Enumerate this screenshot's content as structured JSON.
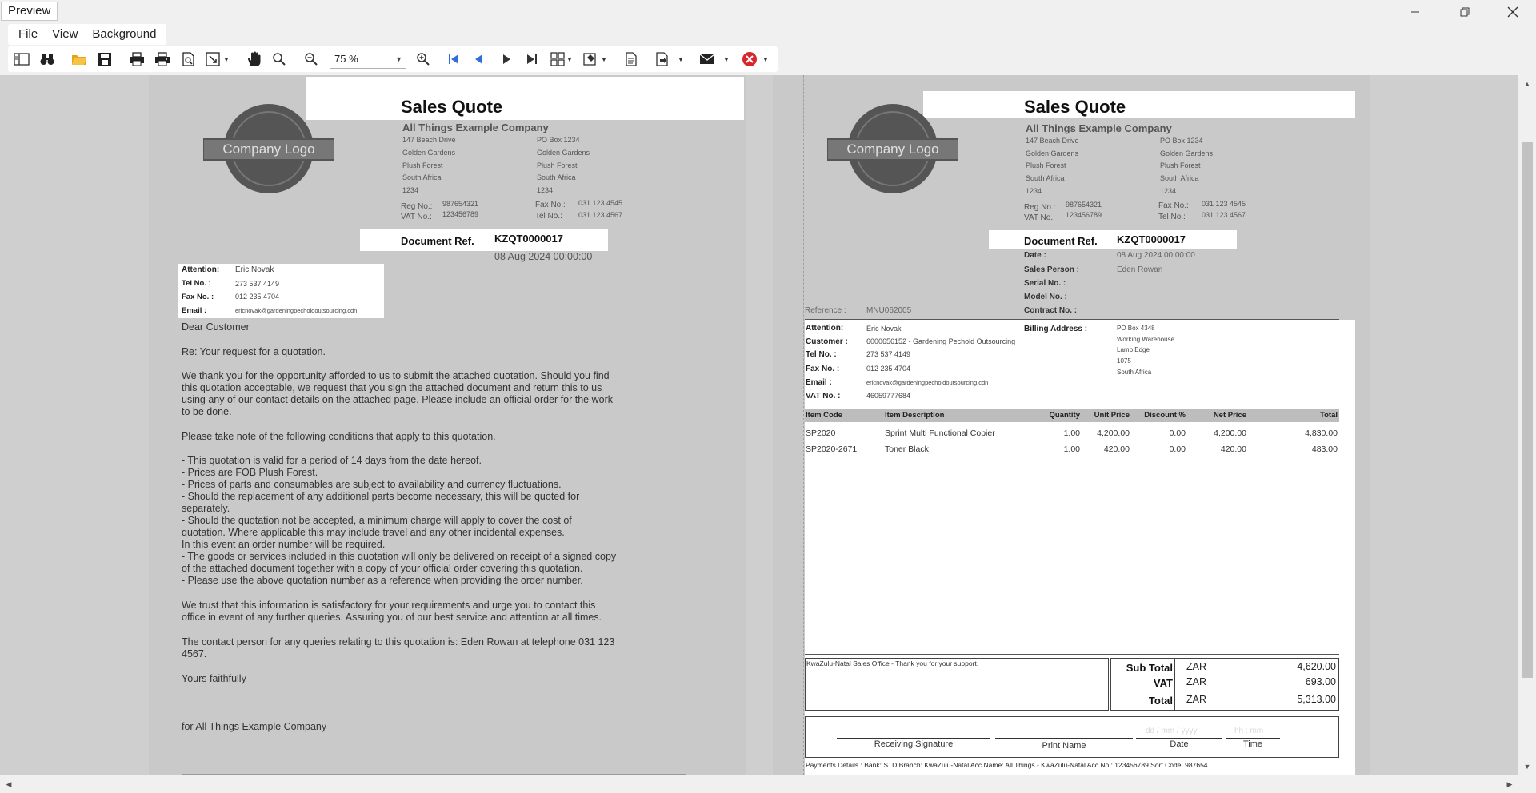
{
  "window": {
    "title": "Preview"
  },
  "menu": {
    "file": "File",
    "view": "View",
    "background": "Background"
  },
  "toolbar": {
    "zoom": "75 %"
  },
  "page1": {
    "title": "Sales Quote",
    "logo_text": "Company Logo",
    "company": "All Things Example Company",
    "address": [
      "147 Beach Drive",
      "Golden Gardens",
      "Plush Forest",
      "South Africa",
      "1234"
    ],
    "postal": [
      "PO Box 1234",
      "Golden Gardens",
      "Plush Forest",
      "South Africa",
      "1234"
    ],
    "reg_label": "Reg No.:",
    "reg_value": "987654321",
    "vat_label": "VAT No.:",
    "vat_value": "123456789",
    "fax_label": "Fax No.:",
    "fax_value": "031 123 4545",
    "tel_label": "Tel No.:",
    "tel_value": "031 123 4567",
    "docref_label": "Document Ref.",
    "docref_value": "KZQT0000017",
    "date": "08 Aug 2024 00:00:00",
    "attention_label": "Attention:",
    "attention_value": "Eric Novak",
    "contact_tel_label": "Tel No. :",
    "contact_tel_value": "273 537 4149",
    "contact_fax_label": "Fax No. :",
    "contact_fax_value": "012 235 4704",
    "email_label": "Email :",
    "email_value": "ericnovak@gardeningpecholdoutsourcing.cdn",
    "letter": [
      "Dear Customer",
      "Re: Your request for a quotation.",
      "We thank you for the opportunity afforded to us to submit the attached quotation. Should you find",
      "this quotation acceptable, we request that you sign the attached document and return this to us",
      "using any of our contact details on the attached page. Please include an official order for the work",
      "to be done.",
      "Please take note of the following conditions that apply to this quotation.",
      "- This quotation is valid for a period of 14 days from the date hereof.",
      "- Prices are FOB Plush Forest.",
      "- Prices of parts and consumables are subject to availability and currency fluctuations.",
      "- Should the replacement of any additional parts become necessary, this will be quoted for",
      "separately.",
      "- Should the quotation not be accepted, a minimum charge will apply to cover the cost of",
      "quotation. Where applicable this may include travel and any other incidental expenses.",
      "In this event an order number will be required.",
      "- The goods or services included in this quotation will only be delivered on receipt of a signed copy",
      "of the attached document together with a copy of your official order covering this quotation.",
      "- Please use the above quotation number as a reference when providing the order number.",
      "We trust that this information is satisfactory for your requirements and urge you to contact this",
      "office in event of any further queries. Assuring you of our best service and attention at all times.",
      "The contact person for any queries relating to this quotation is: Eden Rowan at telephone 031 123",
      "4567.",
      "Yours faithfully",
      "for All Things Example Company"
    ]
  },
  "page2": {
    "title": "Sales Quote",
    "logo_text": "Company Logo",
    "company": "All Things Example Company",
    "address": [
      "147 Beach Drive",
      "Golden Gardens",
      "Plush Forest",
      "South Africa",
      "1234"
    ],
    "postal": [
      "PO Box 1234",
      "Golden Gardens",
      "Plush Forest",
      "South Africa",
      "1234"
    ],
    "reg_label": "Reg No.:",
    "reg_value": "987654321",
    "vat_label": "VAT No.:",
    "vat_value": "123456789",
    "fax_label": "Fax No.:",
    "fax_value": "031 123 4545",
    "tel_label": "Tel No.:",
    "tel_value": "031 123 4567",
    "docref_label": "Document Ref.",
    "docref_value": "KZQT0000017",
    "date_label": "Date :",
    "date_value": "08 Aug 2024 00:00:00",
    "sales_person_label": "Sales Person :",
    "sales_person_value": "Eden Rowan",
    "serial_label": "Serial No. :",
    "model_label": "Model No. :",
    "contract_label": "Contract No. :",
    "reference_label": "Reference :",
    "reference_value": "MNU062005",
    "attention_label": "Attention:",
    "attention_value": "Eric Novak",
    "customer_label": "Customer :",
    "customer_value": "6000656152 - Gardening Pechold Outsourcing",
    "tel_label2": "Tel No. :",
    "tel_value2": "273 537 4149",
    "fax_label2": "Fax No. :",
    "fax_value2": "012 235 4704",
    "email_label": "Email :",
    "email_value": "ericnovak@gardeningpecholdoutsourcing.cdn",
    "vatno_label": "VAT No. :",
    "vatno_value": "46059777684",
    "billing_label": "Billing Address :",
    "billing_lines": [
      "PO Box 4348",
      "Working Warehouse",
      "Lamp Edge",
      "1075",
      "South Africa"
    ],
    "table": {
      "headers": [
        "Item Code",
        "Item Description",
        "Quantity",
        "Unit Price",
        "Discount %",
        "Net Price",
        "Total"
      ],
      "rows": [
        [
          "SP2020",
          "Sprint Multi Functional Copier",
          "1.00",
          "4,200.00",
          "0.00",
          "4,200.00",
          "4,830.00"
        ],
        [
          "SP2020-2671",
          "Toner Black",
          "1.00",
          "420.00",
          "0.00",
          "420.00",
          "483.00"
        ]
      ]
    },
    "note": "KwaZulu-Natal Sales Office - Thank you for your support.",
    "subtotal_label": "Sub Total",
    "subtotal_cur": "ZAR",
    "subtotal_value": "4,620.00",
    "vat_total_label": "VAT",
    "vat_total_cur": "ZAR",
    "vat_total_value": "693.00",
    "total_label": "Total",
    "total_cur": "ZAR",
    "total_value": "5,313.00",
    "receiving_sig": "Receiving Signature",
    "print_name": "Print Name",
    "date_sig": "Date",
    "time_sig": "Time",
    "date_ph": "dd / mm / yyyy",
    "time_ph": "hh : mm",
    "payment": "Payments Details : Bank: STD Branch: KwaZulu-Natal Acc Name: All Things - KwaZulu-Natal Acc No.: 123456789 Sort Code: 987654"
  }
}
